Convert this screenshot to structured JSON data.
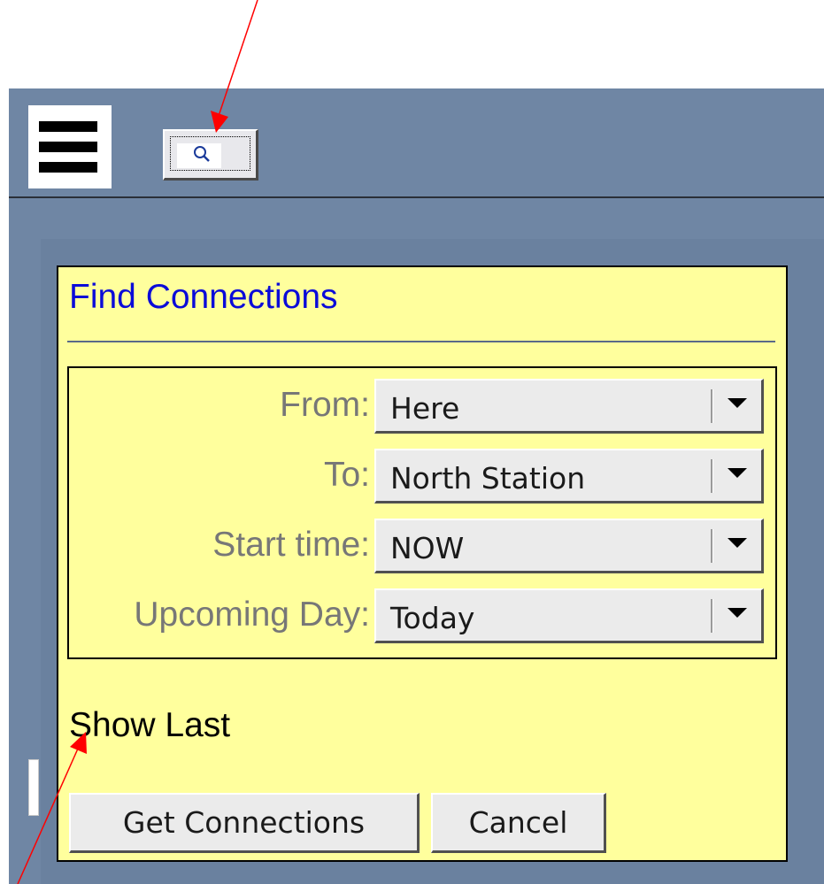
{
  "toolbar": {
    "menu_icon": "hamburger-menu-icon",
    "search_icon": "magnifier-icon"
  },
  "dialog": {
    "title": "Find Connections",
    "fields": [
      {
        "label": "From:",
        "value": "Here"
      },
      {
        "label": "To:",
        "value": "North Station"
      },
      {
        "label": "Start time:",
        "value": "NOW"
      },
      {
        "label": "Upcoming Day:",
        "value": "Today"
      }
    ],
    "show_last_label": "Show Last",
    "get_button_label": "Get Connections",
    "cancel_button_label": "Cancel"
  },
  "colors": {
    "app_background": "#6f86a4",
    "dialog_background": "#ffff9d",
    "title_text": "#0b0bd8",
    "field_label": "#777777",
    "annotation_arrow": "#ff0000"
  }
}
